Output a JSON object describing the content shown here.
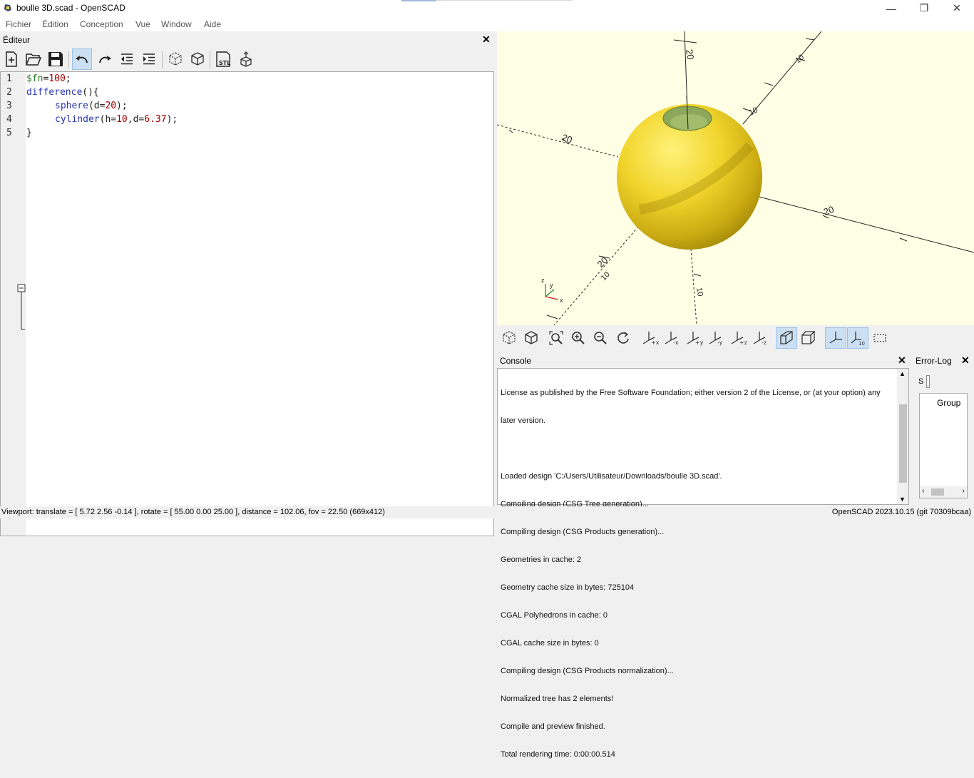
{
  "window": {
    "title": "boulle 3D.scad - OpenSCAD",
    "minimize": "—",
    "restore": "❐",
    "close": "✕"
  },
  "menu": [
    "Fichier",
    "Édition",
    "Conception",
    "Vue",
    "Window",
    "Aide"
  ],
  "editor": {
    "title": "Éditeur",
    "line_numbers": [
      "1",
      "2",
      "3",
      "4",
      "5"
    ],
    "code": {
      "l1_var": "$fn",
      "l1_eq": "=",
      "l1_val": "100",
      "l1_end": ";",
      "l2_kw": "difference",
      "l2_rest": "(){",
      "l3_kw": "sphere",
      "l3_open": "(",
      "l3_param": "d",
      "l3_eq": "=",
      "l3_val": "20",
      "l3_close": ");",
      "l4_kw": "cylinder",
      "l4_open": "(",
      "l4_p1": "h",
      "l4_eq1": "=",
      "l4_v1": "10",
      "l4_comma": ",",
      "l4_p2": "d",
      "l4_eq2": "=",
      "l4_v2": "6.37",
      "l4_close": ");",
      "l5": "}"
    }
  },
  "viewport": {
    "axis_labels": [
      "20",
      "10",
      "10",
      "20",
      "20",
      "10",
      "10",
      "20"
    ],
    "gizmo": {
      "z": "z",
      "y": "y",
      "x": "x"
    },
    "colors": {
      "background": "#ffffe5",
      "sphere": "#f5e03a",
      "hole": "#8ca85a"
    }
  },
  "console": {
    "title": "Console",
    "lines": [
      "License as published by the Free Software Foundation; either version 2 of the License, or (at your option) any",
      "later version.",
      "",
      "Loaded design 'C:/Users/Utilisateur/Downloads/boulle 3D.scad'.",
      "Compiling design (CSG Tree generation)...",
      "Compiling design (CSG Products generation)...",
      "Geometries in cache: 2",
      "Geometry cache size in bytes: 725104",
      "CGAL Polyhedrons in cache: 0",
      "CGAL cache size in bytes: 0",
      "Compiling design (CSG Products normalization)...",
      "Normalized tree has 2 elements!",
      "Compile and preview finished.",
      "Total rendering time: 0:00:00.514"
    ]
  },
  "errorlog": {
    "title": "Error-Log",
    "filter_label": "S",
    "column": "Group"
  },
  "status": {
    "left": "Viewport: translate = [ 5.72 2.56 -0.14 ], rotate = [ 55.00 0.00 25.00 ], distance = 102.06, fov = 22.50 (669x412)",
    "right": "OpenSCAD 2023.10.15 (git 70309bcaa)"
  },
  "icons": {
    "editor_toolbar": [
      "new-file-icon",
      "open-file-icon",
      "save-icon",
      "undo-icon",
      "redo-icon",
      "unindent-icon",
      "indent-icon",
      "preview-icon",
      "render-icon",
      "export-stl-icon",
      "send-to-print-icon"
    ],
    "stl_label": "STL",
    "view_toolbar": [
      "preview-icon",
      "render-icon",
      "view-all-icon",
      "zoom-in-icon",
      "zoom-out-icon",
      "reset-view-icon",
      "view-right-icon",
      "view-left-icon",
      "view-back-icon",
      "view-front-icon",
      "view-top-icon",
      "view-bottom-icon",
      "perspective-icon",
      "orthogonal-icon",
      "show-axes-icon",
      "show-scale-icon",
      "show-edges-icon"
    ]
  }
}
